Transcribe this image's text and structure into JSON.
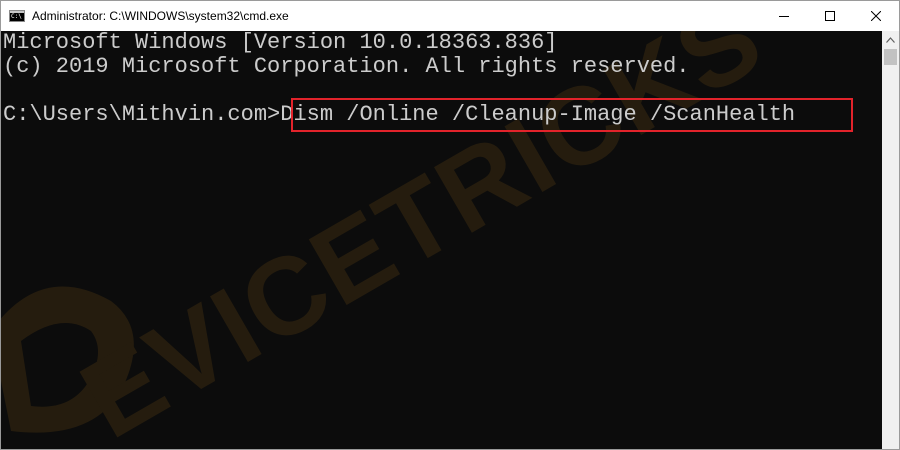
{
  "window": {
    "title": "Administrator: C:\\WINDOWS\\system32\\cmd.exe",
    "icon": "cmd-icon",
    "icon_text": "C:\\"
  },
  "console": {
    "lines": [
      "Microsoft Windows [Version 10.0.18363.836]",
      "(c) 2019 Microsoft Corporation. All rights reserved.",
      "",
      "C:\\Users\\Mithvin.com>Dism /Online /Cleanup-Image /ScanHealth"
    ],
    "foreground_color": "#cccccc",
    "background_color": "#0c0c0c",
    "highlight_color": "#e3232b"
  },
  "watermark": {
    "text": "EVICETRICKS",
    "color": "#3a2a10"
  }
}
